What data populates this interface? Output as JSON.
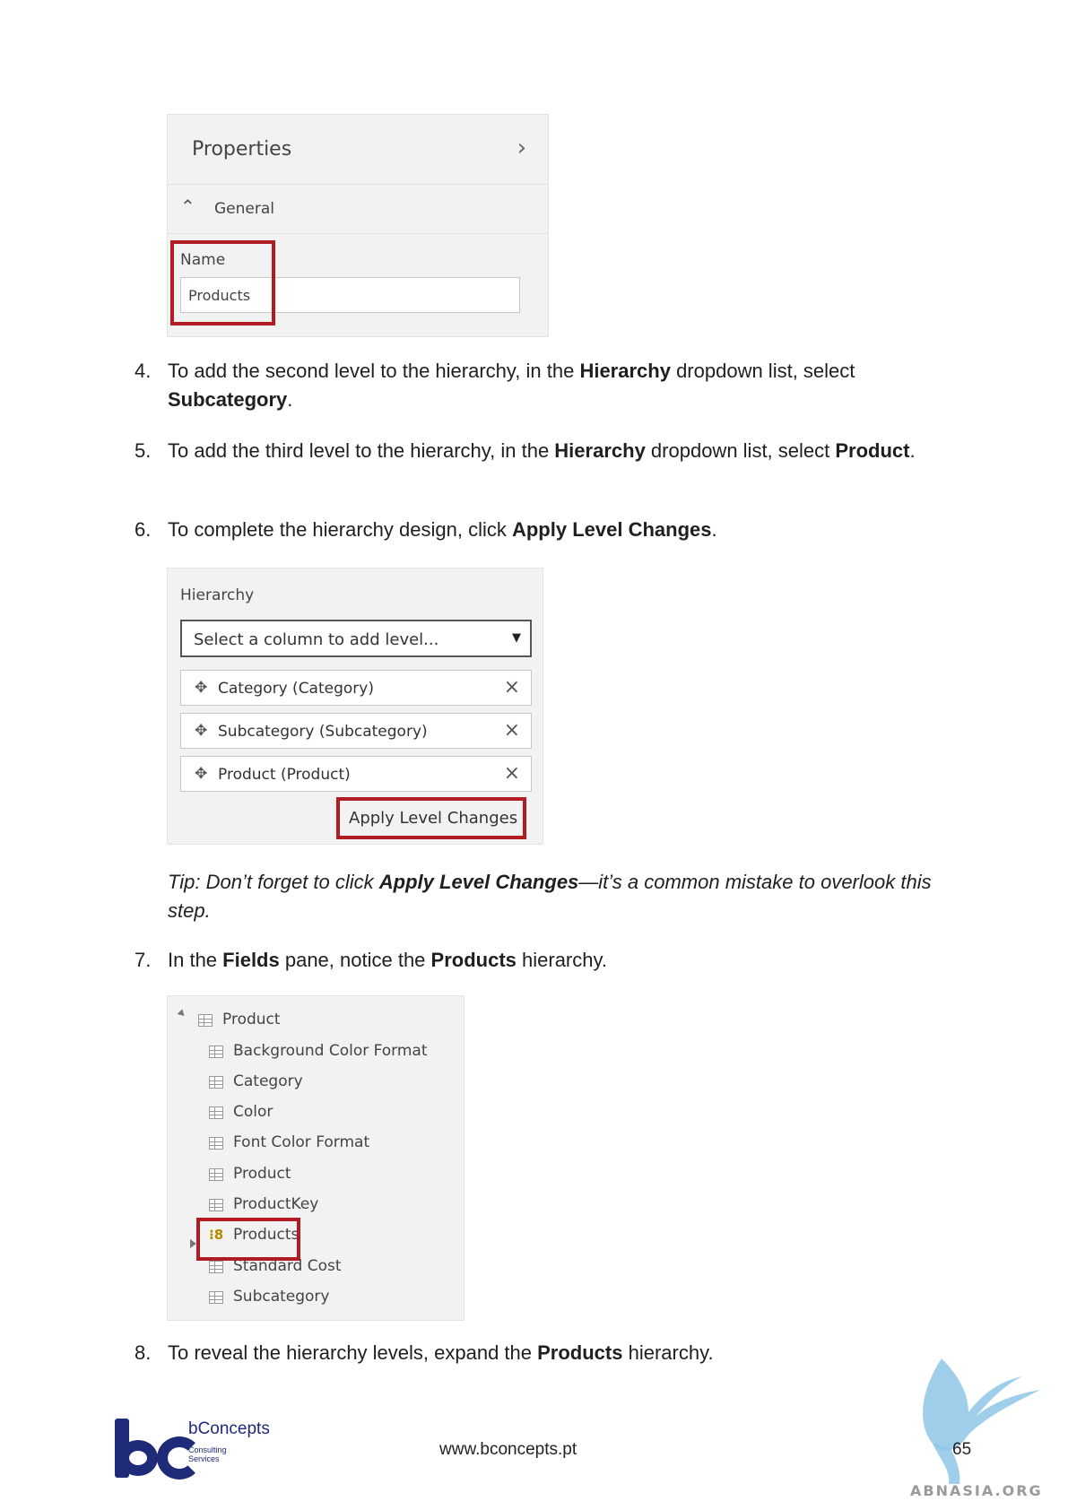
{
  "properties_panel": {
    "title": "Properties",
    "section": "General",
    "name_label": "Name",
    "name_value": "Products"
  },
  "steps": {
    "s4": {
      "num": "4.",
      "t1": "To add the second level to the hierarchy, in the ",
      "b1": "Hierarchy",
      "t2": " dropdown list, select ",
      "b2": "Subcategory",
      "t3": "."
    },
    "s5": {
      "num": "5.",
      "t1": "To add the third level to the hierarchy, in the ",
      "b1": "Hierarchy",
      "t2": " dropdown list, select ",
      "b2": "Product",
      "t3": "."
    },
    "s6": {
      "num": "6.",
      "t1": "To complete the hierarchy design, click ",
      "b1": "Apply Level Changes",
      "t2": "."
    },
    "s7": {
      "num": "7.",
      "t1": "In the ",
      "b1": "Fields",
      "t2": " pane, notice the ",
      "b2": "Products",
      "t3": " hierarchy."
    },
    "s8": {
      "num": "8.",
      "t1": "To reveal the hierarchy levels, expand the ",
      "b1": "Products",
      "t2": " hierarchy."
    }
  },
  "hierarchy_panel": {
    "label": "Hierarchy",
    "select_placeholder": "Select a column to add level...",
    "levels": [
      "Category (Category)",
      "Subcategory (Subcategory)",
      "Product (Product)"
    ],
    "apply_label": "Apply Level Changes"
  },
  "tip": {
    "t1": "Tip: Don’t forget to click ",
    "b1": "Apply Level Changes",
    "t2": "—it’s a common mistake to overlook this step."
  },
  "fields_panel": {
    "table": "Product",
    "fields": [
      "Background Color Format",
      "Category",
      "Color",
      "Font Color Format",
      "Product",
      "ProductKey"
    ],
    "hierarchy": "Products",
    "fields_after": [
      "Standard Cost",
      "Subcategory"
    ]
  },
  "footer": {
    "brand": "bConcepts",
    "brand_sub1": "Consulting",
    "brand_sub2": "Services",
    "url": "www.bconcepts.pt",
    "page": "65",
    "watermark": "ABNASIA.ORG"
  },
  "colors": {
    "highlight": "#b01c22",
    "brand": "#1f2a78",
    "panel_bg": "#f2f2f2"
  }
}
